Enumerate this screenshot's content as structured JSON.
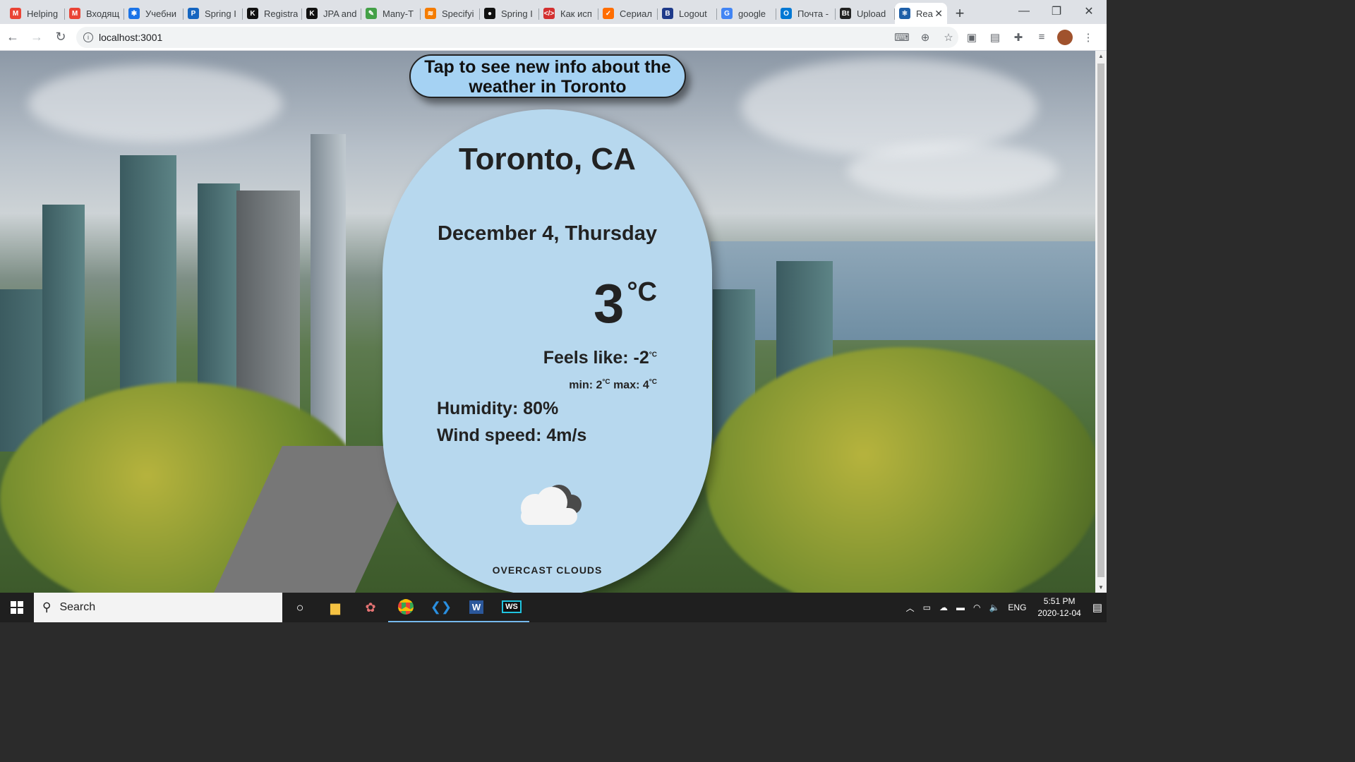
{
  "browser": {
    "tabs": [
      {
        "title": "Helping",
        "color": "#ea4335",
        "glyph": "M"
      },
      {
        "title": "Входящ",
        "color": "#ea4335",
        "glyph": "M"
      },
      {
        "title": "Учебни",
        "color": "#1a73e8",
        "glyph": "✱"
      },
      {
        "title": "Spring I",
        "color": "#1565c0",
        "glyph": "P"
      },
      {
        "title": "Registra",
        "color": "#111111",
        "glyph": "K"
      },
      {
        "title": "JPA and",
        "color": "#111111",
        "glyph": "K"
      },
      {
        "title": "Many-T",
        "color": "#43a047",
        "glyph": "✎"
      },
      {
        "title": "Specifyi",
        "color": "#f57c00",
        "glyph": "≋"
      },
      {
        "title": "Spring I",
        "color": "#111111",
        "glyph": "●"
      },
      {
        "title": "Как исп",
        "color": "#d32f2f",
        "glyph": "</>"
      },
      {
        "title": "Сериал",
        "color": "#ff6d00",
        "glyph": "✓"
      },
      {
        "title": "Logout",
        "color": "#1e3a8a",
        "glyph": "B"
      },
      {
        "title": "google",
        "color": "#4285f4",
        "glyph": "G"
      },
      {
        "title": "Почта -",
        "color": "#0078d4",
        "glyph": "O"
      },
      {
        "title": "Upload",
        "color": "#222222",
        "glyph": "Bt"
      }
    ],
    "active_tab": {
      "title": "Rea",
      "color": "#1e5fa8",
      "glyph": "⚛"
    },
    "new_tab": "+",
    "url": "localhost:3001"
  },
  "weather": {
    "tap_button": "Tap to see new info about the weather in Toronto",
    "city": "Toronto, CA",
    "date": "December 4, Thursday",
    "temp": "3",
    "temp_unit": "°C",
    "feels_label": "Feels like: -2",
    "minmax_min": "min: 2",
    "minmax_max": " max: 4",
    "unit_small": "°C",
    "humidity": "Humidity: 80%",
    "wind": "Wind speed: 4m/s",
    "description": "OVERCAST CLOUDS",
    "icon": "overcast-clouds-icon"
  },
  "taskbar": {
    "search_placeholder": "Search",
    "lang": "ENG",
    "time": "5:51 PM",
    "date": "2020-12-04"
  }
}
